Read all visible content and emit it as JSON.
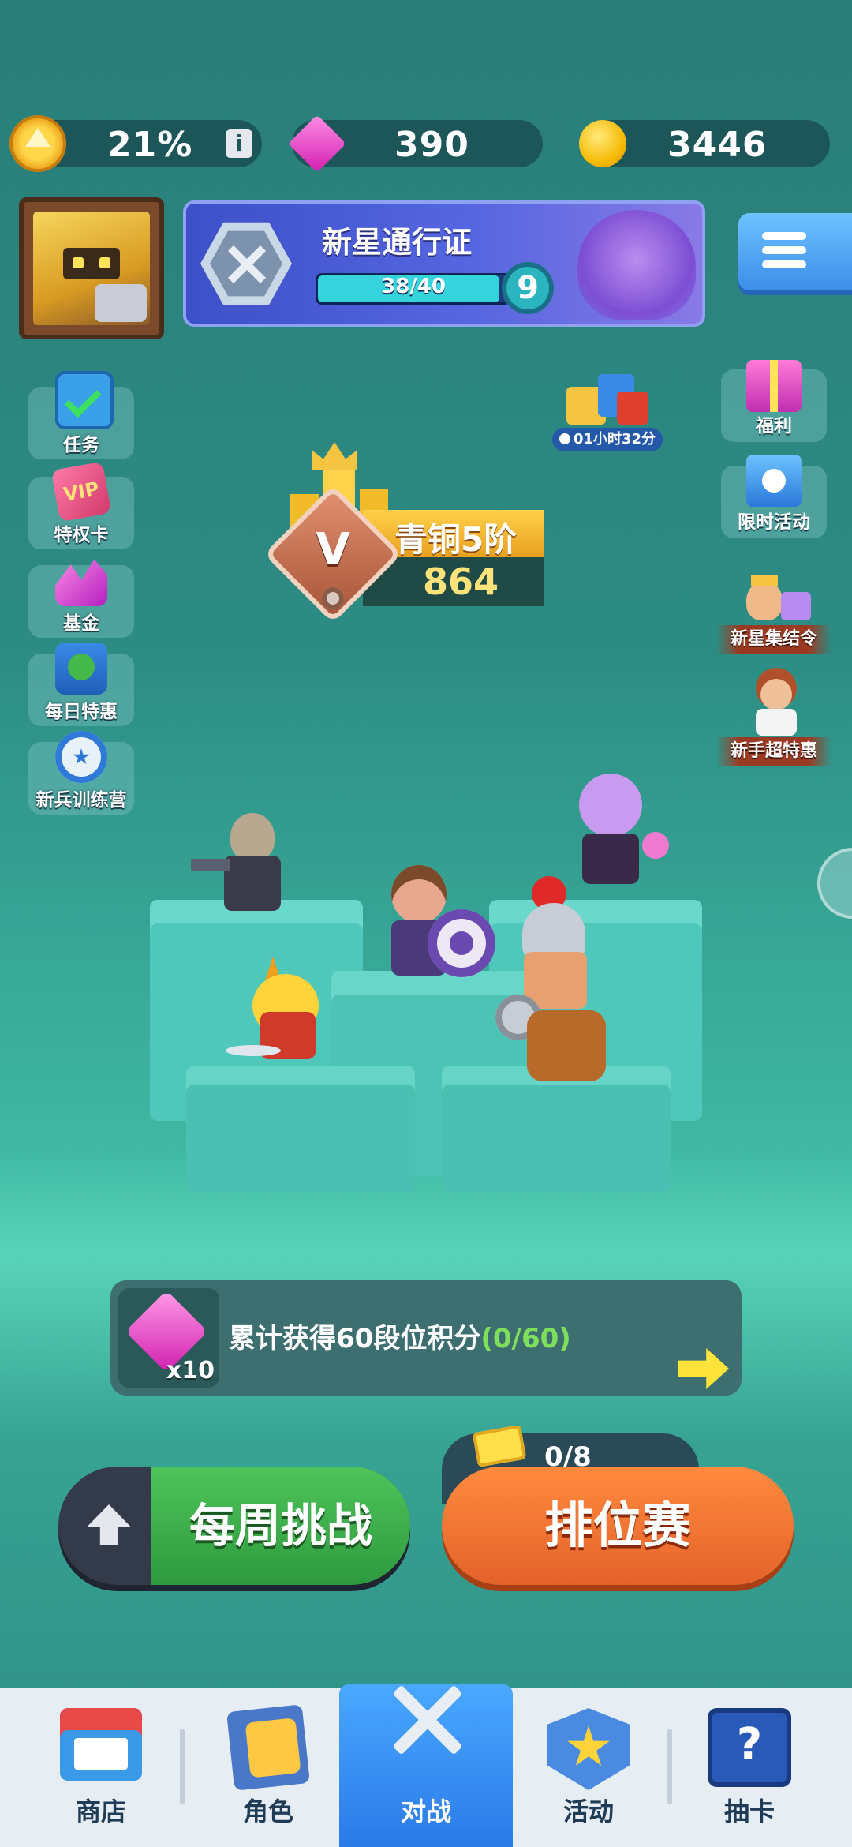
{
  "resources": {
    "level_percent": "21%",
    "gems": "390",
    "coins": "3446"
  },
  "pass": {
    "title": "新星通行证",
    "progress_text": "38/40",
    "progress_fraction": 0.95,
    "level": "9"
  },
  "rank": {
    "badge_letter": "V",
    "name": "青铜5阶",
    "score": "864"
  },
  "left_menu": [
    {
      "label": "任务",
      "icon": "task-clipboard-icon"
    },
    {
      "label": "特权卡",
      "icon": "vip-card-icon"
    },
    {
      "label": "基金",
      "icon": "fund-gem-icon"
    },
    {
      "label": "每日特惠",
      "icon": "daily-deal-icon"
    },
    {
      "label": "新兵训练营",
      "icon": "recruit-camp-icon"
    }
  ],
  "gift_timer": "01小时32分",
  "right_menu": [
    {
      "label": "福利",
      "icon": "gift-box-icon"
    },
    {
      "label": "限时活动",
      "icon": "limited-event-icon"
    },
    {
      "label": "新星集结令",
      "icon": "rally-order-icon"
    },
    {
      "label": "新手超特惠",
      "icon": "newbie-deal-icon"
    }
  ],
  "quest": {
    "text": "累计获得60段位积分",
    "progress": "(0/60)",
    "reward_count": "x10"
  },
  "tickets": "0/8",
  "buttons": {
    "weekly": "每周挑战",
    "ranked": "排位赛"
  },
  "nav": [
    {
      "label": "商店",
      "icon": "shop-icon"
    },
    {
      "label": "角色",
      "icon": "character-icon"
    },
    {
      "label": "对战",
      "icon": "crossed-swords-icon"
    },
    {
      "label": "活动",
      "icon": "event-star-icon"
    },
    {
      "label": "抽卡",
      "icon": "gacha-card-icon"
    }
  ],
  "colors": {
    "accent_green": "#3db04a",
    "accent_orange": "#f0782e",
    "progress_cyan": "#35d3dc",
    "quest_progress_green": "#7ee05a"
  }
}
